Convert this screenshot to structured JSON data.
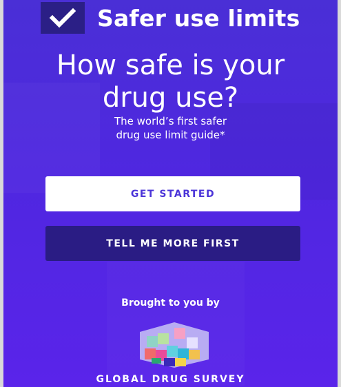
{
  "header": {
    "brand": "Safer use limits",
    "icon": "checkmark-icon"
  },
  "hero": {
    "headline_line1": "How safe is your",
    "headline_line2": "drug use?",
    "sub_line1": "The world’s first safer",
    "sub_line2": "drug use limit guide*"
  },
  "actions": {
    "primary_label": "GET STARTED",
    "secondary_label": "TELL ME MORE FIRST"
  },
  "footer": {
    "brought_by": "Brought to you by",
    "org_name": "GLOBAL DRUG SURVEY",
    "logo_icon": "cube-logo-icon"
  },
  "colors": {
    "background": "#4f27e0",
    "dark_accent": "#2a1c84",
    "button_text": "#4b34d8"
  }
}
